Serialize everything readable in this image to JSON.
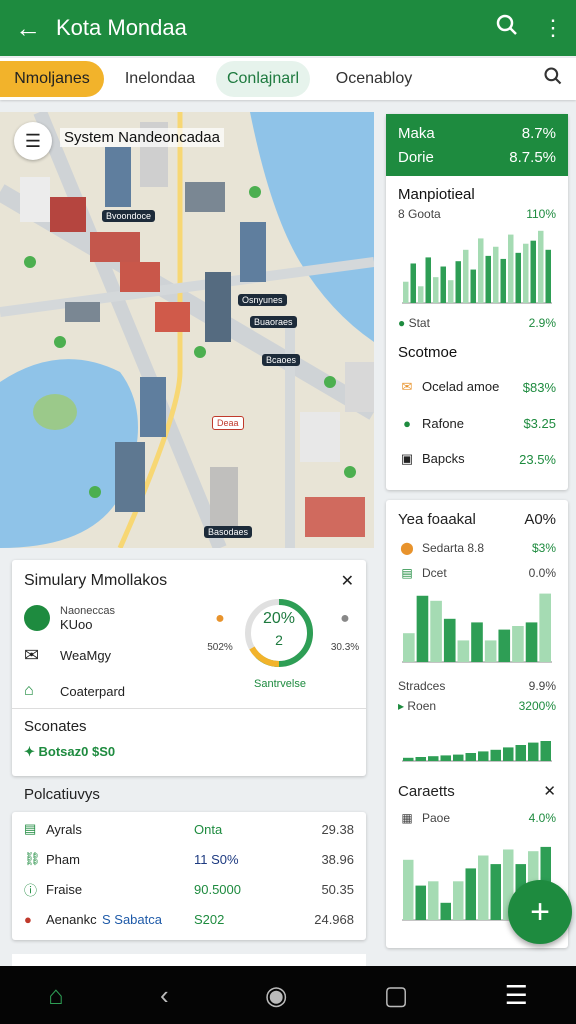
{
  "appbar": {
    "title": "Kota Mondaa",
    "back_icon": "arrow-left-icon",
    "search_icon": "search-icon",
    "more_icon": "more-vert-icon"
  },
  "tabs": [
    {
      "label": "Nmoljanes"
    },
    {
      "label": "Inelondaa"
    },
    {
      "label": "Conlajnarl"
    },
    {
      "label": "Ocenabloy"
    }
  ],
  "map": {
    "title": "System Nandeoncadaa",
    "pins": [
      "Bvoondoce",
      "Osnyunes",
      "Buaoraes",
      "Bcaoes",
      "Deaa",
      "Basodaes"
    ]
  },
  "right_top": {
    "header": [
      {
        "label": "Maka",
        "value": "8.7%"
      },
      {
        "label": "Dorie",
        "value": "8.7.5%"
      }
    ],
    "section1": {
      "title": "Manpiotieal",
      "sub_label": "8 Goota",
      "sub_value": "110%"
    },
    "bars1": [
      28,
      52,
      22,
      60,
      34,
      48,
      30,
      55,
      70,
      44,
      85,
      62,
      74,
      58,
      90,
      66,
      78,
      82,
      95,
      70
    ],
    "stat": {
      "label": "Stat",
      "value": "2.9%"
    },
    "section2": {
      "title": "Scotmoe"
    },
    "items": [
      {
        "icon": "mail-icon",
        "label": "Ocelad amoe",
        "value": "$83%"
      },
      {
        "icon": "leaf-icon",
        "label": "Rafone",
        "value": "$3.25"
      },
      {
        "icon": "bus-icon",
        "label": "Bapcks",
        "value": "23.5%"
      }
    ]
  },
  "right_bottom": {
    "title": "Yea foaakal",
    "title_value": "A0%",
    "row1": {
      "label": "Sedarta 8.8",
      "value": "$3%"
    },
    "row2": {
      "label": "Dcet",
      "value": "0.0%"
    },
    "bars2": [
      40,
      92,
      85,
      60,
      30,
      55,
      30,
      45,
      50,
      55,
      95
    ],
    "sec2": {
      "label": "Stradces",
      "value": "9.9%"
    },
    "sec2_row": {
      "label": "Roen",
      "value": "3200%"
    },
    "bars3": [
      8,
      10,
      12,
      14,
      16,
      20,
      24,
      28,
      34,
      40,
      46,
      50
    ],
    "sec3": {
      "title": "Caraetts"
    },
    "sec3_row": {
      "label": "Paoe",
      "value": "4.0%"
    },
    "bars4": [
      70,
      40,
      45,
      20,
      45,
      60,
      75,
      65,
      82,
      65,
      80,
      85
    ]
  },
  "left_card": {
    "title": "Simulary Mmollakos",
    "rows": [
      {
        "icon": "shield-icon",
        "label": "Naoneccas",
        "sub": "KUoo"
      },
      {
        "icon": "mail-icon",
        "label": "WeaMgy"
      },
      {
        "icon": "store-icon",
        "label": "Coaterpard"
      }
    ],
    "left_pin_label": "502%",
    "right_pin_label": "30.3%",
    "gauge_value": "20%",
    "gauge_number": "2",
    "gauge_label": "Santrvelse",
    "section": {
      "title": "Sconates",
      "value": "Botsaz0 $S0"
    }
  },
  "policy": {
    "title": "Polcatiuvys",
    "rows": [
      {
        "icon": "doc-icon",
        "c1": "Ayrals",
        "c2": "Onta",
        "c3": "29.38"
      },
      {
        "icon": "chain-icon",
        "c1": "Pham",
        "c2": "11 S0%",
        "c3": "38.96"
      },
      {
        "icon": "info-icon",
        "c1": "Fraise",
        "c2": "90.5000",
        "c3": "50.35"
      },
      {
        "icon": "alert-icon",
        "c1": "Aenankc",
        "c1b": "S Sabatca",
        "c2": "S202",
        "c3": "24.968"
      }
    ]
  },
  "colors": {
    "primary": "#1e8b3f",
    "accent": "#f2b32b",
    "bar": "#2e9e55",
    "bar_light": "#a5dbb3"
  },
  "nav": {
    "home": "home-icon",
    "back": "nav-back-icon",
    "home_circle": "nav-home-icon",
    "recent": "nav-recent-icon",
    "menu": "menu-icon"
  }
}
